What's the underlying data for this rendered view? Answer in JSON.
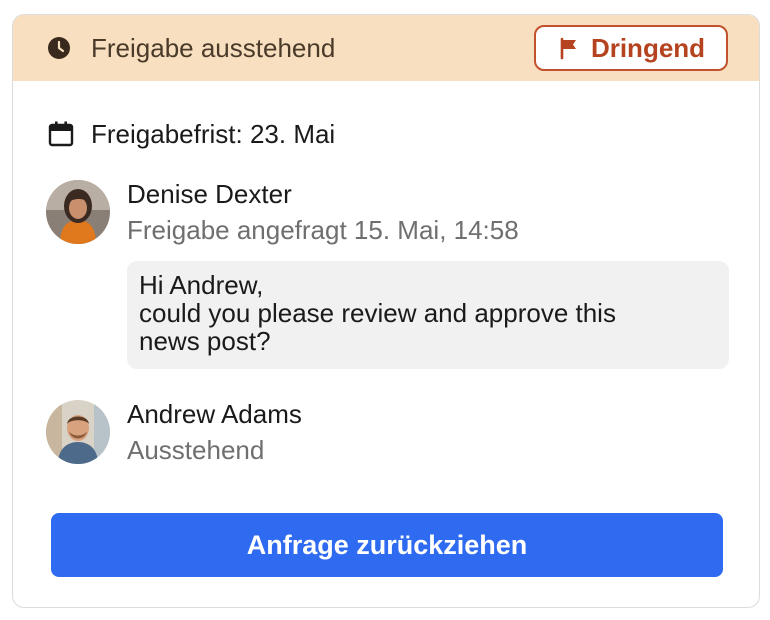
{
  "header": {
    "status": "Freigabe ausstehend",
    "status_icon": "clock-icon",
    "badge_label": "Dringend",
    "badge_icon": "flag-icon"
  },
  "deadline": {
    "icon": "calendar-icon",
    "text": "Freigabefrist: 23. Mai"
  },
  "requester": {
    "name": "Denise Dexter",
    "subtitle": "Freigabe angefragt 15. Mai, 14:58",
    "message_lines": [
      "Hi Andrew,",
      "could you please review and approve this",
      "news post?"
    ]
  },
  "approver": {
    "name": "Andrew Adams",
    "status": "Ausstehend"
  },
  "action": {
    "label": "Anfrage zurückziehen"
  },
  "colors": {
    "header_bg": "#f8dfbf",
    "badge_accent": "#c0522d",
    "button_bg": "#2f6bf0",
    "message_bg": "#f1f1f1"
  }
}
